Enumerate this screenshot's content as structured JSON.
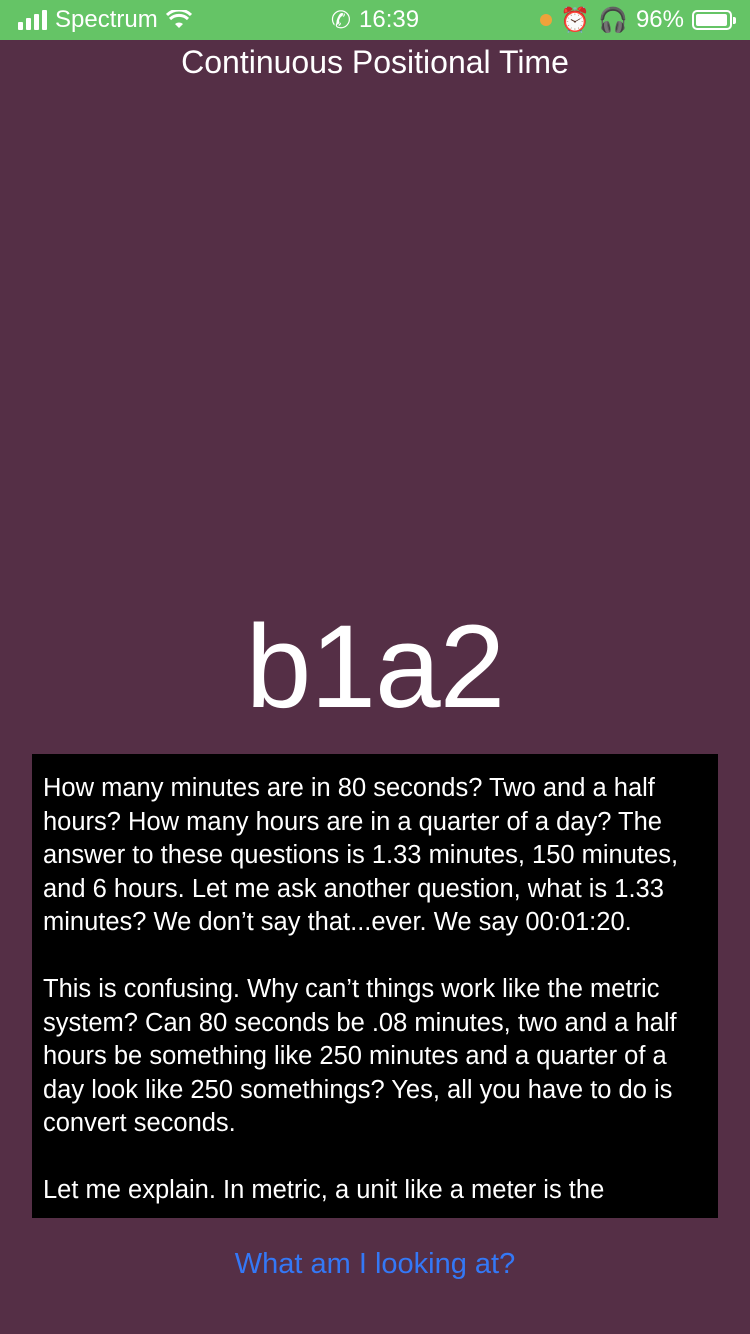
{
  "status_bar": {
    "carrier": "Spectrum",
    "time": "16:39",
    "battery": "96%",
    "battery_level": 0.96,
    "background_color": "#65c466",
    "icons": [
      "signal-icon",
      "wifi-icon",
      "phone-icon",
      "orange-dot-icon",
      "alarm-icon",
      "headphones-icon",
      "battery-icon"
    ]
  },
  "app": {
    "title": "Continuous Positional Time",
    "code": "b1a2",
    "background_color": "#552f46"
  },
  "explanation": {
    "paragraphs": [
      "How many minutes are in 80 seconds? Two and a half hours? How many hours are in a quarter of a day? The answer to these questions is 1.33 minutes, 150 minutes, and 6 hours. Let me ask another question, what is 1.33 minutes? We don’t say that...ever. We say 00:01:20.",
      "This is confusing. Why can’t things work like the metric system? Can 80 seconds be .08 minutes, two and a half hours be something like 250 minutes and a quarter of a day look like 250 somethings? Yes, all you have to do is convert seconds.",
      "Let me explain. In metric, a unit like a meter is the"
    ]
  },
  "footer": {
    "link": "What am I looking at?",
    "link_color": "#3478f6"
  }
}
